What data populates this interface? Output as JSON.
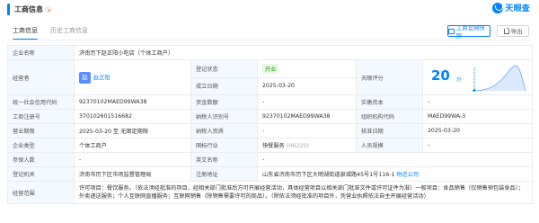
{
  "header": {
    "title": "工商信息",
    "logo_text": "天眼查",
    "tabs": [
      "工商信息",
      "历史工商信息"
    ],
    "official_button": "工商官网快照",
    "export_button": "导出"
  },
  "colors": {
    "accent": "#0084ff",
    "label_bg": "#f4f8ff",
    "status_green": "#2fa21c"
  },
  "info": {
    "company_name_label": "企业名称",
    "company_name": "济南历下赵正阳小吃店（个体工商户）",
    "operator_label": "经营者",
    "operator_initial": "赵",
    "operator_name": "赵正阳",
    "status_label": "登记状态",
    "status": "开业",
    "established_label": "成立日期",
    "established": "2025-03-20",
    "score_label": "天眼评分",
    "score": "20",
    "score_unit": "分",
    "capital_label": "资金数额",
    "capital": "-",
    "paid_label": "实缴资本",
    "paid": "-",
    "credit_code_label": "统一社会信用代码",
    "credit_code": "92370102MAED99WA38",
    "reg_no_label": "工商注册号",
    "reg_no": "370102601516682",
    "tax_id_label": "纳税人识别号",
    "tax_id": "92370102MAED99WA38",
    "org_code_label": "组织机构代码",
    "org_code": "MAED99WA-3",
    "term_label": "营业期限",
    "term": "2025-03-20 至 无固定期限",
    "taxpayer_q_label": "纳税人资质",
    "taxpayer_q": "-",
    "approved_label": "核准日期",
    "approved": "2025-03-20",
    "type_label": "企业类型",
    "type": "个体工商户",
    "industry_label": "国标行业",
    "industry": "快餐服务",
    "industry_code": "(H6220)",
    "staff_label": "人员规模",
    "staff": "-",
    "insured_label": "参保人数",
    "insured": "-",
    "en_name_label": "英文名称",
    "en_name": "-",
    "authority_label": "登记机关",
    "authority": "济南市历下区市场监督管理局",
    "address_label": "注册地址",
    "address": "山东省济南市历下区大明湖街道泉城路45号1号116-1",
    "address_link": "附近公司",
    "scope_label": "经营范围",
    "scope": "许可项目：餐饮服务。（依法须经批准的项目，经相关部门批准后方可开展经营活动，具体经营项目以相关部门批准文件或许可证件为准）一般项目：食品销售（仅销售预包装食品）；外卖递送服务；个人互联网直播服务；互联网销售（除销售需要许可的商品）。（除依法须经批准的项目外，凭营业执照依法自主开展经营活动）"
  }
}
